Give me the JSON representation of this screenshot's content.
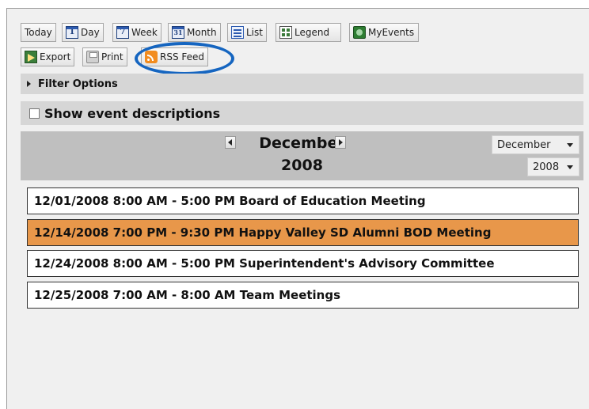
{
  "toolbar": {
    "today": "Today",
    "day": "Day",
    "day_icon": "1",
    "week": "Week",
    "week_icon": "7",
    "month": "Month",
    "month_icon": "31",
    "list": "List",
    "legend": "Legend",
    "myevents": "MyEvents",
    "export": "Export",
    "print": "Print",
    "rss": "RSS Feed"
  },
  "filter_options": "Filter Options",
  "show_descriptions": "Show event descriptions",
  "nav": {
    "month": "December",
    "year": "2008",
    "month_select": "December",
    "year_select": "2008"
  },
  "events": [
    "12/01/2008 8:00 AM - 5:00 PM Board of Education Meeting",
    "12/14/2008 7:00 PM - 9:30 PM Happy Valley SD Alumni BOD Meeting",
    "12/24/2008 8:00 AM - 5:00 PM Superintendent's Advisory Committee",
    "12/25/2008 7:00 AM - 8:00 AM Team Meetings"
  ],
  "colors": {
    "highlight_event": "#e8974a",
    "annotation_circle": "#1565c0",
    "rss_icon": "#f28c1f"
  }
}
